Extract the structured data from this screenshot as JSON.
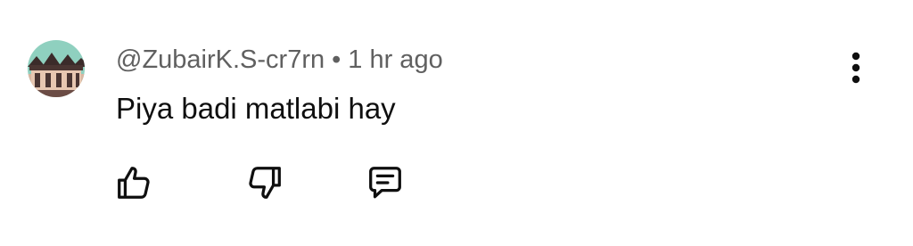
{
  "comment": {
    "author": "@ZubairK.S-cr7rn",
    "separator": "•",
    "timestamp": "1 hr ago",
    "text": "Piya badi matlabi hay"
  },
  "icons": {
    "avatar": "avatar-image",
    "more": "more-vert-icon",
    "like": "thumb-up-icon",
    "dislike": "thumb-down-icon",
    "reply": "comment-reply-icon"
  },
  "colors": {
    "meta_text": "#606060",
    "body_text": "#0f0f0f",
    "icon": "#0f0f0f"
  }
}
